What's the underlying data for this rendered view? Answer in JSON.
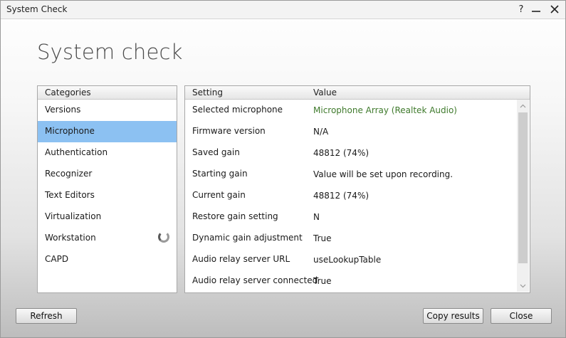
{
  "window": {
    "title": "System Check"
  },
  "titlebar": {
    "help_glyph": "?",
    "minimize_icon": "minimize-icon",
    "close_icon": "close-icon"
  },
  "page": {
    "heading": "System check"
  },
  "categories": {
    "header": "Categories",
    "items": [
      {
        "label": "Versions",
        "selected": false
      },
      {
        "label": "Microphone",
        "selected": true
      },
      {
        "label": "Authentication",
        "selected": false
      },
      {
        "label": "Recognizer",
        "selected": false
      },
      {
        "label": "Text Editors",
        "selected": false
      },
      {
        "label": "Virtualization",
        "selected": false
      },
      {
        "label": "Workstation",
        "selected": false,
        "loading": true
      },
      {
        "label": "CAPD",
        "selected": false
      }
    ]
  },
  "settings": {
    "header_setting": "Setting",
    "header_value": "Value",
    "rows": [
      {
        "setting": "Selected microphone",
        "value": "Microphone Array (Realtek Audio)",
        "highlight": true
      },
      {
        "setting": "Firmware version",
        "value": "N/A"
      },
      {
        "setting": "Saved gain",
        "value": "48812 (74%)"
      },
      {
        "setting": "Starting gain",
        "value": "Value will be set upon recording."
      },
      {
        "setting": "Current gain",
        "value": "48812 (74%)"
      },
      {
        "setting": "Restore gain setting",
        "value": "N"
      },
      {
        "setting": "Dynamic gain adjustment",
        "value": "True"
      },
      {
        "setting": "Audio relay server URL",
        "value": "useLookupTable"
      },
      {
        "setting": "Audio relay server connected",
        "value": "True"
      }
    ]
  },
  "buttons": {
    "refresh": "Refresh",
    "copy": "Copy results",
    "close": "Close"
  },
  "colors": {
    "selection": "#8cc1f2",
    "highlight_value": "#3f7a2c"
  }
}
